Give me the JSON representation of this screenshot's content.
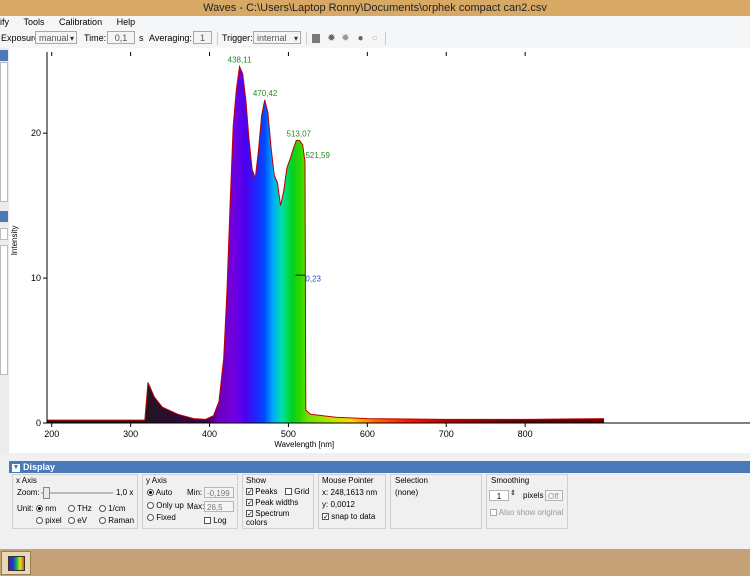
{
  "window": {
    "title": "Waves  -  C:\\Users\\Laptop Ronny\\Documents\\orphek compact can2.csv"
  },
  "menu": {
    "items": [
      "ify",
      "Tools",
      "Calibration",
      "Help"
    ]
  },
  "toolbar": {
    "exposure_label": "Exposure:",
    "exposure_value": "manual",
    "time_label": "Time:",
    "time_value": "0,1",
    "time_unit": "s",
    "averaging_label": "Averaging:",
    "averaging_value": "1",
    "trigger_label": "Trigger:",
    "trigger_value": "internal",
    "icons": [
      "save-icon",
      "burst-icon",
      "burst-dim-icon",
      "record-dot-icon",
      "stop-circle-icon"
    ]
  },
  "chart_data": {
    "type": "area",
    "xlabel": "Wavelength [nm]",
    "ylabel": "Intensity",
    "xlim": [
      194,
      1085
    ],
    "ylim": [
      0,
      25.6
    ],
    "xticks": [
      200,
      300,
      400,
      500,
      600,
      700,
      800
    ],
    "yticks": [
      0,
      10,
      20
    ],
    "grid": false,
    "color_mode": "spectrum colors",
    "peaks": [
      {
        "label": "438,11",
        "x": 438.11,
        "y": 24.6
      },
      {
        "label": "470,42",
        "x": 470.42,
        "y": 22.3
      },
      {
        "label": "513,07",
        "x": 513.07,
        "y": 19.5
      },
      {
        "label": "521,59",
        "x": 521.59,
        "y": 18.0
      },
      {
        "label": "0,23",
        "x": 521.5,
        "y": 9.5
      }
    ],
    "series": [
      {
        "x": [
          194,
          300,
          318,
          322,
          326,
          330,
          340,
          360,
          380,
          395,
          405,
          412,
          418,
          422,
          426,
          430,
          434,
          438,
          442,
          446,
          450,
          454,
          458,
          462,
          466,
          470,
          474,
          478,
          482,
          486,
          490,
          494,
          498,
          502,
          506,
          510,
          514,
          518,
          521,
          522,
          528,
          560,
          600,
          700,
          800,
          900
        ],
        "y": [
          0.2,
          0.2,
          0.2,
          2.8,
          2.3,
          1.8,
          1.1,
          0.6,
          0.3,
          0.25,
          0.5,
          1.5,
          4.5,
          9.0,
          15.0,
          20.5,
          23.0,
          24.6,
          24.1,
          22.3,
          19.6,
          17.5,
          16.9,
          18.8,
          21.2,
          22.3,
          21.4,
          19.0,
          17.1,
          16.6,
          15.0,
          16.0,
          17.6,
          18.2,
          18.9,
          19.5,
          19.5,
          19.2,
          18.0,
          0.9,
          0.6,
          0.4,
          0.3,
          0.25,
          0.25,
          0.3
        ]
      }
    ]
  },
  "display": {
    "header": "Display",
    "xaxis": {
      "title": "x Axis",
      "zoom_label": "Zoom:",
      "zoom_value": "1,0 x",
      "unit_label": "Unit:",
      "options": [
        "nm",
        "THz",
        "1/cm",
        "pixel",
        "eV",
        "Raman"
      ],
      "selected": "nm"
    },
    "yaxis": {
      "title": "y Axis",
      "options": [
        "Auto",
        "Only up",
        "Fixed"
      ],
      "selected": "Auto",
      "min_label": "Min:",
      "min_value": "-0,199",
      "max_label": "Max:",
      "max_value": "26,5",
      "log_label": "Log"
    },
    "show": {
      "title": "Show",
      "peaks": "Peaks",
      "grid": "Grid",
      "peak_widths": "Peak widths",
      "spectrum_colors": "Spectrum colors"
    },
    "mouse": {
      "title": "Mouse Pointer",
      "x": "x: 248,1613 nm",
      "y": "y: 0,0012",
      "snap": "snap to data"
    },
    "selection": {
      "title": "Selection",
      "value": "(none)"
    },
    "smoothing": {
      "title": "Smoothing",
      "pixels_value": "1",
      "pixels_label": "pixels",
      "off_label": "Off",
      "also_show": "Also show original"
    }
  }
}
